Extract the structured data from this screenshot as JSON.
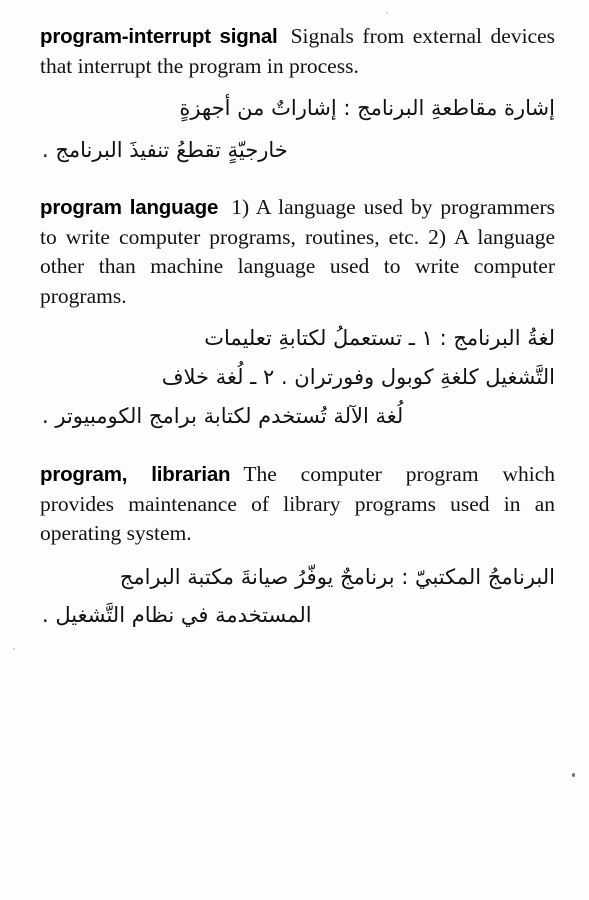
{
  "page": {
    "background_color": "#fdfdfb",
    "text_color": "#121212",
    "language_primary": "English",
    "language_secondary": "Arabic"
  },
  "entries": [
    {
      "headword": "program-interrupt signal",
      "definition_en": "Signals from external devices that interrupt the program in process.",
      "arabic_lines": [
        "إشارة مقاطعةِ البرنامج : إشاراتٌ من أجهزةٍ",
        "خارجيّةٍ تقطعُ تنفيذَ البرنامج ."
      ]
    },
    {
      "headword": "program language",
      "definition_en": "1) A language used by programmers to write computer programs, routines, etc. 2) A language other than machine language used to write computer programs.",
      "arabic_lines": [
        "لغةُ البرنامج : ١ ـ تستعملُ لكتابةِ تعليمات",
        "التَّشغيل كلغةِ كوبول وفورتران . ٢ ـ لُغة خلاف",
        "لُغة الآلة تُستخدم لكتابة برامج الكومبيوتر ."
      ]
    },
    {
      "headword": "program, librarian",
      "definition_en": "The computer program which provides maintenance of library programs used in an operating system.",
      "arabic_lines": [
        "البرنامجُ المكتبيّ : برنامجٌ يوفّرُ صيانةَ مكتبة البرامج",
        "المستخدمة في نظام التَّشغيل ."
      ]
    }
  ]
}
